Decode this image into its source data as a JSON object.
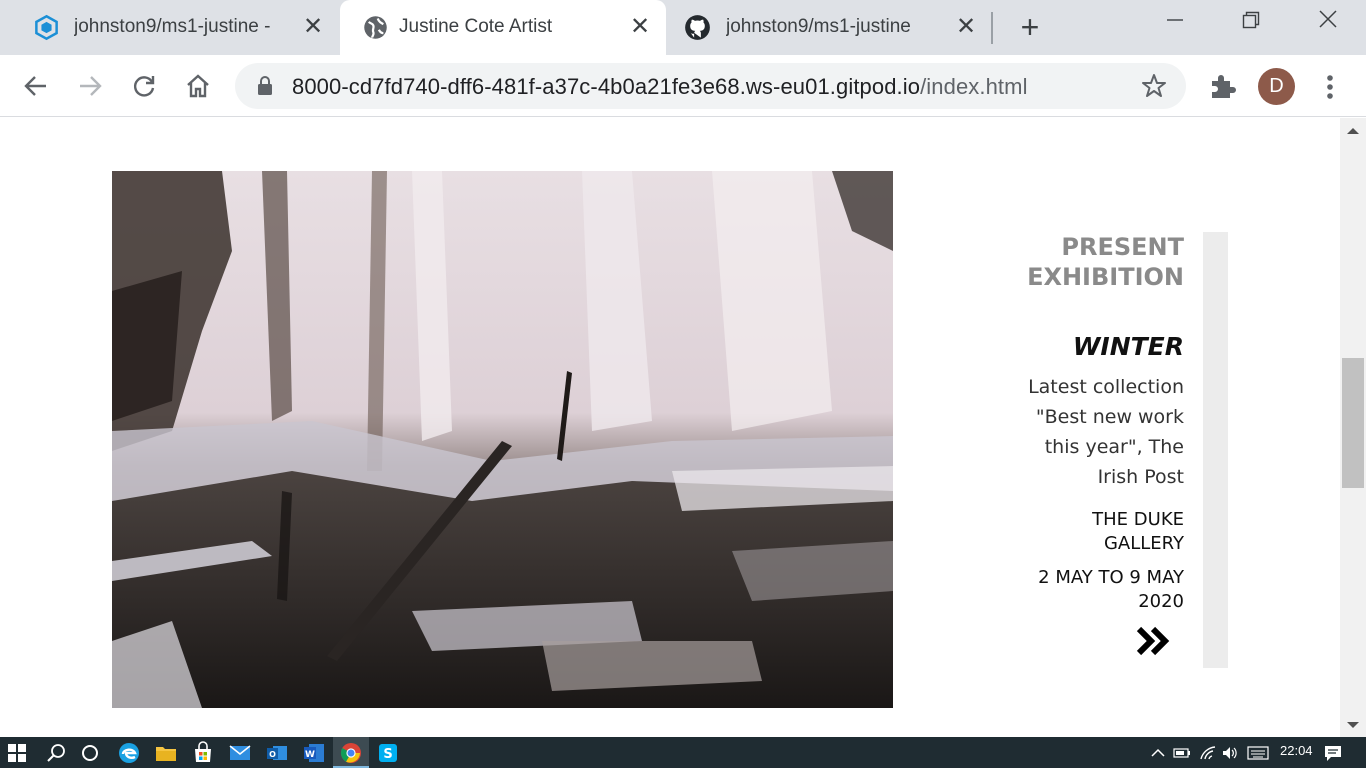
{
  "browser": {
    "tabs": [
      {
        "title": "johnston9/ms1-justine -",
        "favicon": "gitpod-icon",
        "active": false
      },
      {
        "title": "Justine Cote Artist",
        "favicon": "globe-icon",
        "active": true
      },
      {
        "title": "johnston9/ms1-justine",
        "favicon": "github-icon",
        "active": false
      }
    ],
    "close_glyph": "✕",
    "new_tab_glyph": "+",
    "url_host": "8000-cd7fd740-dff6-481f-a37c-4b0a21fe3e68.ws-eu01.gitpod.io",
    "url_path": "/index.html",
    "profile_initial": "D",
    "accent": "#1a73e8"
  },
  "exhibition": {
    "heading_line1": "PRESENT",
    "heading_line2": "EXHIBITION",
    "title": "WINTER",
    "desc_line1": "Latest collection",
    "desc_line2": "\"Best new work",
    "desc_line3": "this year\", The",
    "desc_line4": "Irish Post",
    "venue_line1": "THE DUKE",
    "venue_line2": "GALLERY",
    "dates_line1": "2 MAY TO 9 MAY",
    "dates_line2": "2020",
    "more_glyph": "»"
  },
  "taskbar": {
    "clock": "22:04"
  }
}
